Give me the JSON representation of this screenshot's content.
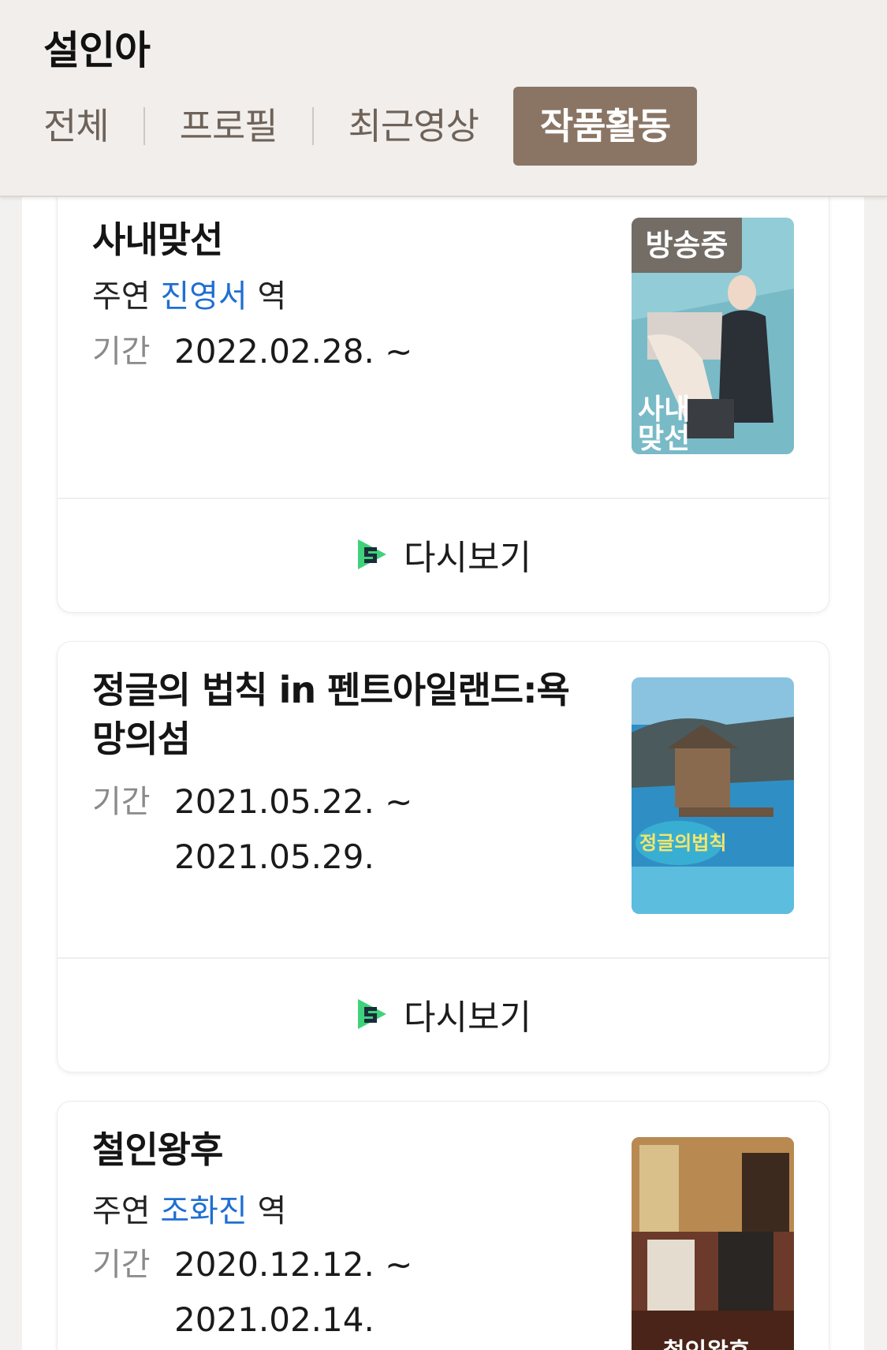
{
  "header": {
    "name": "설인아",
    "tabs": [
      {
        "label": "전체"
      },
      {
        "label": "프로필"
      },
      {
        "label": "최근영상"
      },
      {
        "label": "작품활동"
      }
    ]
  },
  "works": [
    {
      "title": "사내맞선",
      "role_prefix": "주연",
      "role_name": "진영서",
      "role_suffix": "역",
      "period_label": "기간",
      "period": "2022.02.28. ~",
      "badge": "방송중",
      "poster_text": "사내\n맞선",
      "replay_label": "다시보기"
    },
    {
      "title": "정글의 법칙 in 펜트아일랜드:욕망의섬",
      "period_label": "기간",
      "period": "2021.05.22. ~ 2021.05.29.",
      "poster_text": "정글의법칙",
      "replay_label": "다시보기"
    },
    {
      "title": "철인왕후",
      "role_prefix": "주연",
      "role_name": "조화진",
      "role_suffix": "역",
      "period_label": "기간",
      "period": "2020.12.12. ~ 2021.02.14.",
      "poster_text": "철인왕후"
    }
  ],
  "colors": {
    "active_tab": "#8a7565",
    "link": "#1f6fd1",
    "replay_icon_green": "#3fd27b",
    "replay_icon_dark": "#1c2b3a"
  }
}
